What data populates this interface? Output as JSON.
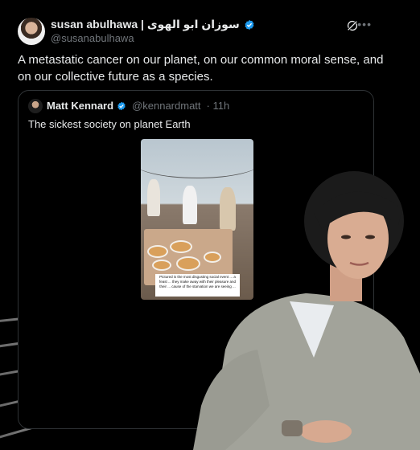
{
  "author": {
    "display_name": "susan abulhawa | سوزان ابو الهوى",
    "handle": "@susanabulhawa"
  },
  "tweet": {
    "text": "A metastatic cancer on our planet, on our common moral sense, and on our collective future as a species."
  },
  "quoted": {
    "display_name": "Matt Kennard",
    "handle": "@kennardmatt",
    "time": "· 11h",
    "text": "The sickest society on planet Earth",
    "media_caption": "Pictured is the most disgusting social event ... a feast ... they make away with their pleasure and their ... cause of the starvation we are seeing ..."
  },
  "colors": {
    "verified": "#1d9bf0",
    "secondary_text": "#71767b",
    "border": "#2f3336"
  },
  "icons": [
    "verified-badge-icon",
    "grok-icon",
    "more-icon"
  ]
}
